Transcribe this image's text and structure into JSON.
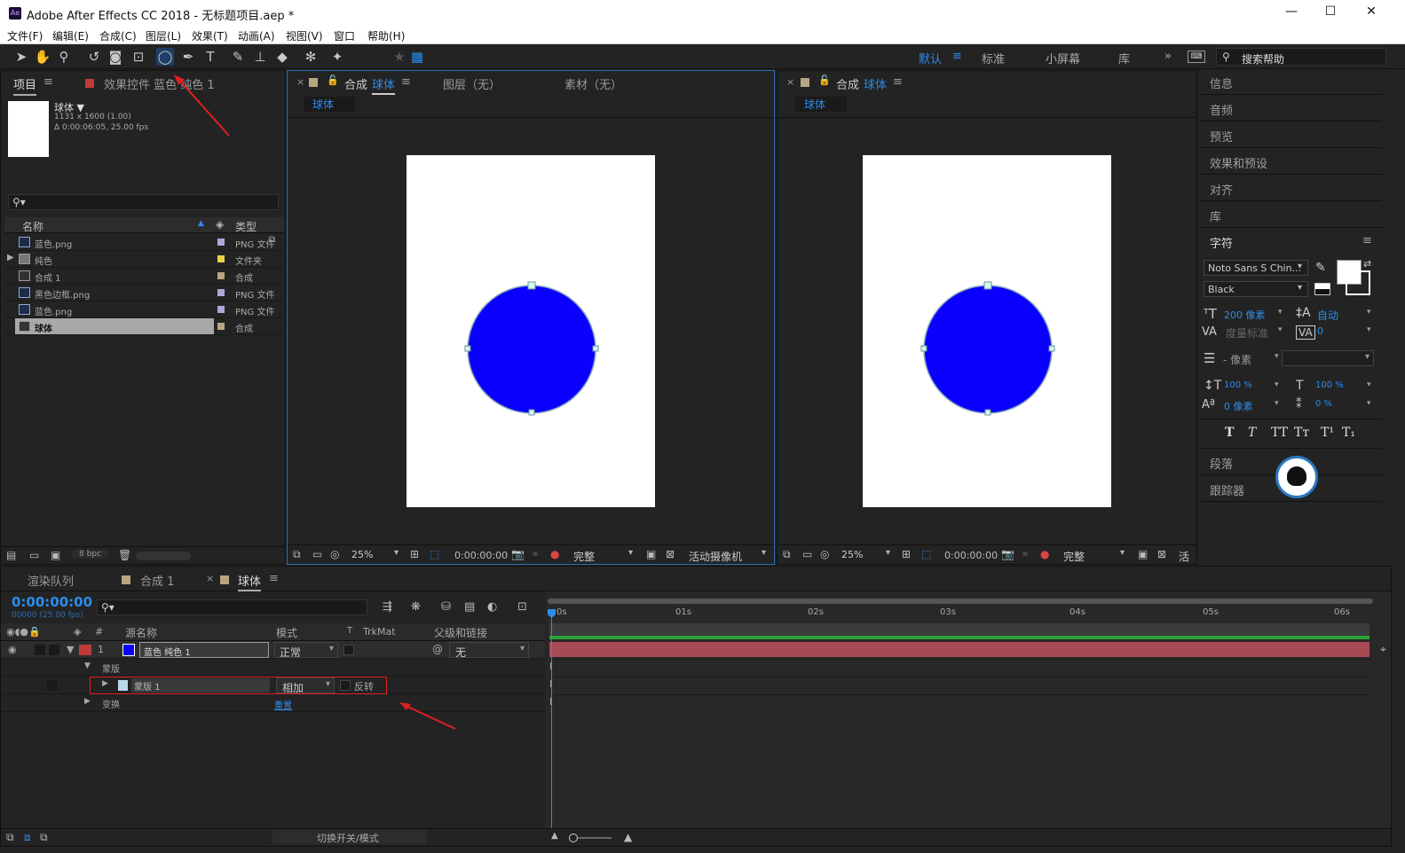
{
  "window": {
    "app_label": "Ae",
    "title": "Adobe After Effects CC 2018 - 无标题项目.aep *",
    "minimize": "—",
    "maximize": "☐",
    "close": "✕"
  },
  "menu": [
    "文件(F)",
    "编辑(E)",
    "合成(C)",
    "图层(L)",
    "效果(T)",
    "动画(A)",
    "视图(V)",
    "窗口",
    "帮助(H)"
  ],
  "workspaces": {
    "default": "默认",
    "standard": "标准",
    "small": "小屏幕",
    "library": "库",
    "more": "»"
  },
  "search_help": {
    "placeholder": "搜索帮助"
  },
  "project_panel": {
    "tab_project": "项目",
    "tab_effects": "效果控件 蓝色 纯色 1",
    "selected_name": "球体 ▼",
    "selected_size": "1131 x 1600 (1.00)",
    "selected_duration": "Δ 0:00:06:05, 25.00 fps",
    "col_name": "名称",
    "col_type": "类型",
    "items": [
      {
        "name": "蓝色.png",
        "type": "PNG 文件",
        "label_color": "#b0a6d8"
      },
      {
        "name": "纯色",
        "type": "文件夹",
        "label_color": "#e6d24b"
      },
      {
        "name": "合成 1",
        "type": "合成",
        "label_color": "#b9a580"
      },
      {
        "name": "黑色边框.png",
        "type": "PNG 文件",
        "label_color": "#b0a6d8"
      },
      {
        "name": "蓝色.png",
        "type": "PNG 文件",
        "label_color": "#b0a6d8"
      },
      {
        "name": "球体",
        "type": "合成",
        "label_color": "#b9a580"
      }
    ],
    "bpc": "8 bpc"
  },
  "comp_viewer_left": {
    "tab_close": "×",
    "tab_label": "合成",
    "comp_name": "球体",
    "tab_layer": "图层（无）",
    "tab_footage": "素材（无）",
    "breadcrumb": "球体",
    "zoom": "25%",
    "timecode": "0:00:00:00",
    "quality": "完整",
    "camera": "活动摄像机"
  },
  "comp_viewer_right": {
    "tab_close": "×",
    "tab_label": "合成",
    "comp_name": "球体",
    "breadcrumb": "球体",
    "zoom": "25%",
    "timecode": "0:00:00:00",
    "quality": "完整",
    "camera": "活"
  },
  "right_panels": [
    "信息",
    "音频",
    "预览",
    "效果和预设",
    "对齐",
    "库",
    "字符"
  ],
  "character": {
    "font": "Noto Sans S Chin...",
    "style": "Black",
    "size": "200 像素",
    "leading": "自动",
    "kerning": "度量标准",
    "tracking": "0",
    "stroke": "- 像素",
    "vscale": "100 %",
    "hscale": "100 %",
    "baseline": "0 像素",
    "tsume": "0 %"
  },
  "text_styles": [
    "T",
    "T",
    "TT",
    "Tт",
    "T¹",
    "T₁"
  ],
  "paragraph": "段落",
  "tracker": "跟踪器",
  "timeline": {
    "tab_render": "渲染队列",
    "tab_comp1": "合成 1",
    "tab_sphere": "球体",
    "tab_close": "×",
    "timecode": "0:00:00:00",
    "frame_info": "00000 (25.00 fps)",
    "col_source": "源名称",
    "col_mode": "模式",
    "col_t": "T",
    "col_trkmat": "TrkMat",
    "col_parent": "父级和链接",
    "layer": {
      "index": "1",
      "name": "蓝色 纯色 1",
      "mode": "正常",
      "parent": "无",
      "color": "#c03a3a"
    },
    "mask_group": "蒙版",
    "mask_name": "蒙版 1",
    "mask_mode": "相加",
    "invert": "反转",
    "transform": "变换",
    "reset": "重置",
    "ruler": [
      "0s",
      "01s",
      "02s",
      "03s",
      "04s",
      "05s",
      "06s"
    ],
    "footer_toggle": "切换开关/模式"
  },
  "colors": {
    "accent": "#2d8ceb",
    "circle": "#0a00ff",
    "layer_bar": "#a74a55",
    "work_area": "#2da23b",
    "annotation": "#e02020"
  }
}
